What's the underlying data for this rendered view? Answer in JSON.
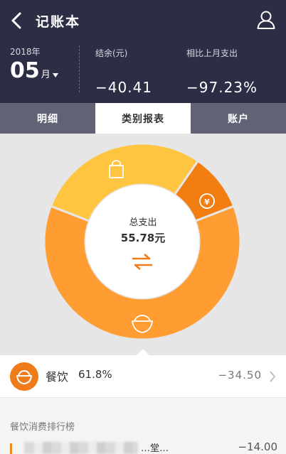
{
  "app": {
    "title": "记账本"
  },
  "summary": {
    "year": "2018年",
    "month": "05",
    "month_unit": "月",
    "balance_label": "结余(元)",
    "balance_value": "−40.41",
    "compare_label": "相比上月支出",
    "compare_value": "−97.23%"
  },
  "tabs": [
    {
      "label": "明细",
      "active": false
    },
    {
      "label": "类别报表",
      "active": true
    },
    {
      "label": "账户",
      "active": false
    }
  ],
  "chart": {
    "center_label": "总支出",
    "center_value": "55.78元",
    "colors": {
      "dining": "#ff9d33",
      "shopping": "#ffc440",
      "money": "#f27d10"
    }
  },
  "chart_data": {
    "type": "pie",
    "total": 55.78,
    "slices": [
      {
        "category": "餐饮",
        "percent": 61.8,
        "amount": 34.5,
        "color": "#ff9d33",
        "icon": "rice-bowl-icon"
      },
      {
        "category": "",
        "percent": 28.7,
        "color": "#ffc440",
        "icon": "shopping-bag-icon"
      },
      {
        "category": "",
        "percent": 9.5,
        "color": "#f27d10",
        "icon": "yuan-coin-icon"
      }
    ]
  },
  "selected_category": {
    "name": "餐饮",
    "percent": "61.8%",
    "amount": "−34.50",
    "icon": "rice-bowl-icon"
  },
  "ranking": {
    "title": "餐饮消费排行榜",
    "items": [
      {
        "name": "…堂…",
        "amount": "−14.00"
      }
    ]
  }
}
